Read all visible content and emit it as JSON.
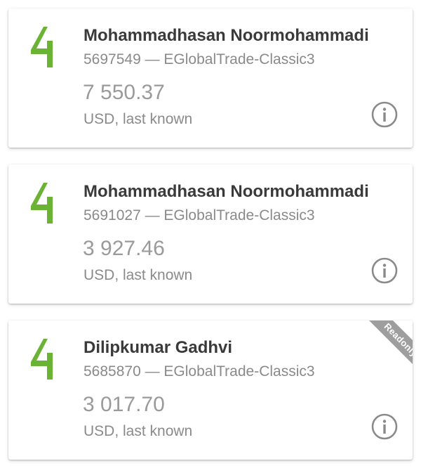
{
  "accent_color": "#6ab335",
  "accounts": [
    {
      "name": "Mohammadhasan Noormohammadi",
      "details": "5697549 — EGlobalTrade-Classic3",
      "balance": "7 550.37",
      "currency_note": "USD, last known",
      "info_icon": "info-circle-icon"
    },
    {
      "name": "Mohammadhasan Noormohammadi",
      "details": "5691027 — EGlobalTrade-Classic3",
      "balance": "3 927.46",
      "currency_note": "USD, last known",
      "info_icon": "info-circle-icon"
    },
    {
      "name": "Dilipkumar Gadhvi",
      "details": "5685870 — EGlobalTrade-Classic3",
      "balance": "3 017.70",
      "currency_note": "USD, last known",
      "info_icon": "info-circle-icon",
      "badge": "Readonly"
    }
  ]
}
